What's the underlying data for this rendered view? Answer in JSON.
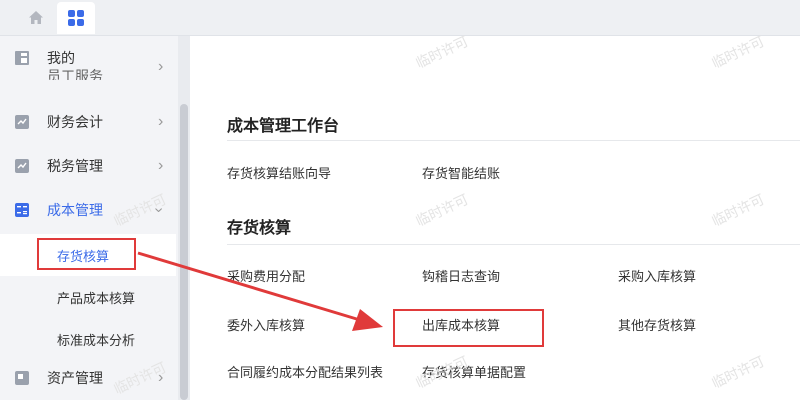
{
  "nav": {
    "mine": "我的",
    "employee_service": "员工服务",
    "finance": "财务会计",
    "tax": "税务管理",
    "cost": "成本管理",
    "cost_sub": [
      "存货核算",
      "产品成本核算",
      "标准成本分析"
    ],
    "assets": "资产管理"
  },
  "main": {
    "section1_title": "成本管理工作台",
    "section1_links": [
      "存货核算结账向导",
      "存货智能结账"
    ],
    "section2_title": "存货核算",
    "section2_links": [
      "采购费用分配",
      "钩稽日志查询",
      "采购入库核算",
      "委外入库核算",
      "出库成本核算",
      "其他存货核算",
      "合同履约成本分配结果列表",
      "存货核算单据配置"
    ]
  },
  "watermark": "临时许可",
  "colors": {
    "accent": "#3b6be8",
    "annotation": "#e03a3a"
  }
}
